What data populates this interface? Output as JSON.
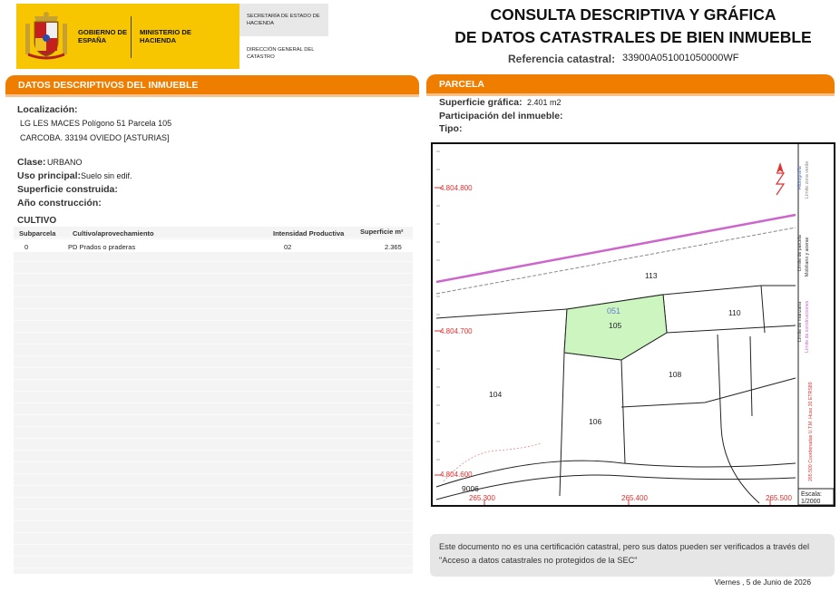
{
  "header": {
    "gobierno": "GOBIERNO DE ESPAÑA",
    "ministerio": "MINISTERIO DE HACIENDA",
    "secretaria": "SECRETARÍA DE ESTADO DE HACIENDA",
    "direccion": "DIRECCIÓN GENERAL DEL CATASTRO",
    "title_line1": "CONSULTA DESCRIPTIVA Y GRÁFICA",
    "title_line2": "DE DATOS CATASTRALES DE BIEN INMUEBLE",
    "ref_label": "Referencia catastral:",
    "ref_value": "33900A051001050000WF",
    "brand_color": "#ef7d00",
    "logo_color": "#f7c600"
  },
  "left_panel": {
    "title": "DATOS DESCRIPTIVOS DEL INMUEBLE",
    "localizacion_label": "Localización:",
    "localizacion_line1": "LG LES MACES  Polígono 51 Parcela 105",
    "localizacion_line2": "CARCOBA. 33194 OVIEDO [ASTURIAS]",
    "clase_label": "Clase:",
    "clase_value": "URBANO",
    "uso_label": "Uso principal:",
    "uso_value": "Suelo sin edif.",
    "superficie_label": "Superficie construida:",
    "anio_label": "Año construcción:",
    "cultivo_title": "CULTIVO",
    "table": {
      "headers": [
        "Subparcela",
        "Cultivo/aprovechamiento",
        "Intensidad Productiva",
        "Superficie m²"
      ],
      "rows": [
        [
          "0",
          "PD Prados o praderas",
          "02",
          "2.365"
        ]
      ]
    }
  },
  "right_panel": {
    "title": "PARCELA",
    "superficie_label": "Superficie gráfica:",
    "superficie_value": "2.401 m2",
    "participacion_label": "Participación del inmueble:",
    "tipo_label": "Tipo:",
    "map": {
      "y_coord_1": "4.804.800",
      "y_coord_2": "4.804.700",
      "y_coord_3": "4.804.600",
      "x_coord_1": "265.300",
      "x_coord_2": "265.400",
      "x_coord_3": "265.500",
      "parcel_highlight": "051",
      "parcels": [
        "113",
        "105",
        "110",
        "108",
        "104",
        "106",
        "9006"
      ],
      "scale_label": "Escala:",
      "scale_value": "1/2000",
      "legend": [
        "Hidrografía",
        "Límite zona verde",
        "Límite de parcela",
        "Mobiliario y aceras",
        "Límite de manzana",
        "Límite de construcciones"
      ],
      "utm_text": "265.500 Coordenadas U.T.M. Huso 30 ETRS89",
      "highlight_color": "#ccf5c0",
      "hydro_color": "#cc66cc",
      "coord_color": "#e03030"
    }
  },
  "notice": {
    "text": "Este documento no es una certificación catastral, pero sus datos pueden ser verificados a través del \"Acceso a datos catastrales no protegidos de la SEC\""
  },
  "footer": {
    "date": "Viernes , 5 de Junio de 2026"
  }
}
